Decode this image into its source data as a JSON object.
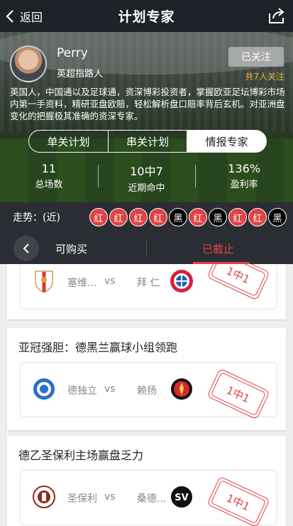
{
  "header": {
    "back_label": "返回",
    "title": "计划专家"
  },
  "expert": {
    "name": "Perry",
    "role": "英超指路人",
    "follow_label": "已关注",
    "followers": "共7人关注",
    "bio": "英国人，中国通以及足球通，资深博彩投资者，掌握欧亚足坛博彩市场内第一手资料，精研亚盘欧赔，轻松解析盘口赔率背后玄机。对亚洲盘变化的把握极其准确的资深专家。"
  },
  "segments": [
    "单关计划",
    "串关计划",
    "情报专家"
  ],
  "stats": [
    {
      "value": "11",
      "label": "总场数"
    },
    {
      "value": "10中7",
      "label": "近期命中"
    },
    {
      "value": "136%",
      "label": "盈利率"
    }
  ],
  "trend": {
    "label": "走势：(近)",
    "results": [
      "红",
      "红",
      "红",
      "红",
      "黑",
      "红",
      "黑",
      "红",
      "红",
      "黑"
    ]
  },
  "tabs": {
    "buy_label": "可购买",
    "closed_label": "已截止"
  },
  "cards": [
    {
      "title": "",
      "home": "塞维...",
      "vs": "vs",
      "away": "拜 仁",
      "result": "1中1"
    },
    {
      "title": "亚冠强胆：德黑兰赢球小组领跑",
      "home": "德独立",
      "vs": "vs",
      "away": "赖扬",
      "result": "1中1"
    },
    {
      "title": "德乙圣保利主场赢盘乏力",
      "home": "圣保利",
      "vs": "vs",
      "away": "桑德...",
      "result": "1中1"
    }
  ],
  "colors": {
    "accent_red": "#e04343",
    "follow_gold": "#f0b23a",
    "dark_bg": "#2a2d33"
  }
}
